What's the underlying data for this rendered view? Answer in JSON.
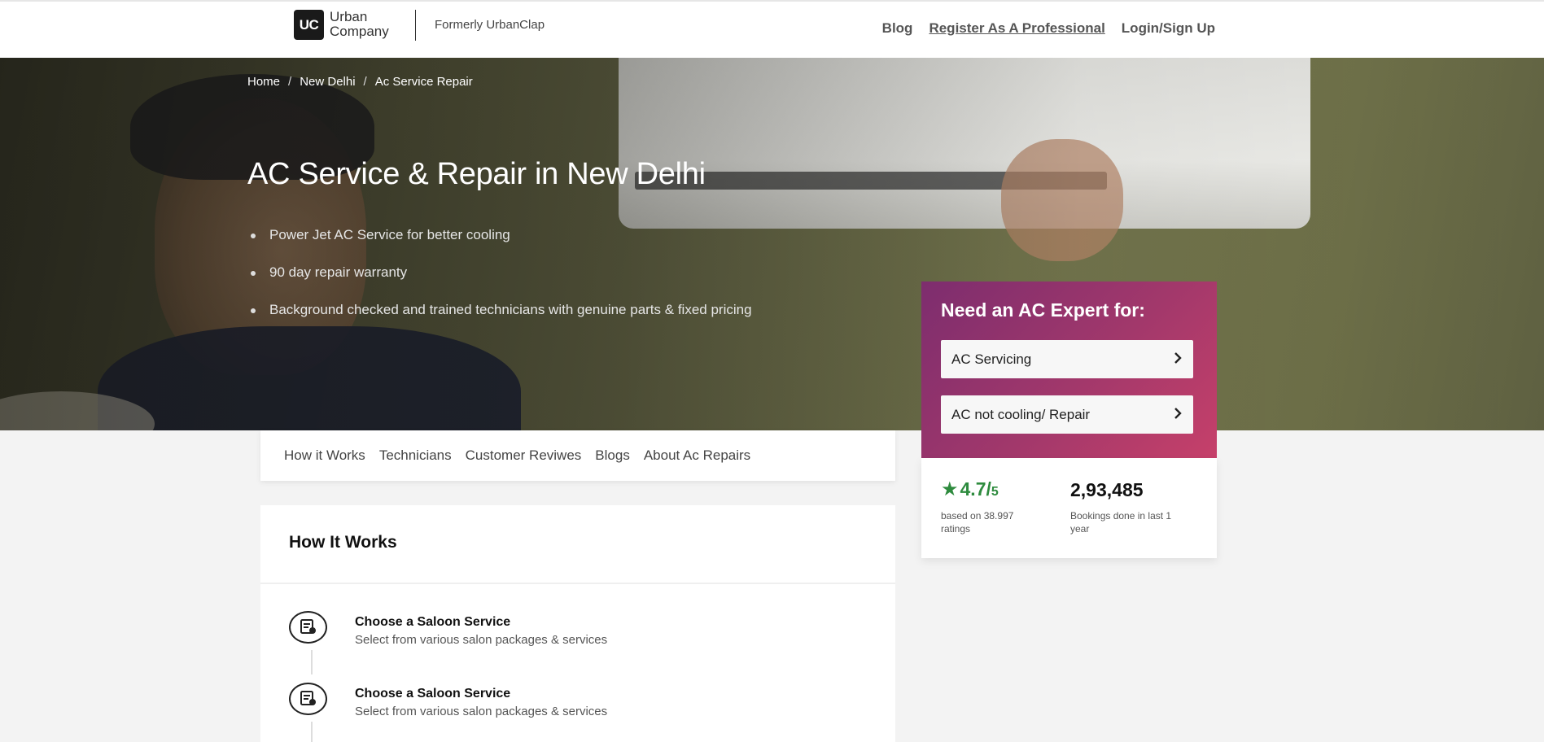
{
  "header": {
    "logo_mark": "UC",
    "logo_name_1": "Urban",
    "logo_name_2": "Company",
    "formerly": "Formerly UrbanClap",
    "nav": {
      "blog": "Blog",
      "register": "Register As A Professional",
      "login": "Login/Sign Up"
    }
  },
  "breadcrumb": {
    "home": "Home",
    "city": "New Delhi",
    "current": "Ac Service Repair",
    "separator": "/"
  },
  "hero": {
    "title": "AC Service & Repair in New Delhi",
    "bullets": [
      "Power Jet AC Service for better cooling",
      "90 day repair warranty",
      "Background checked and trained technicians with genuine parts & fixed pricing"
    ]
  },
  "expert_card": {
    "title": "Need an AC Expert for:",
    "options": [
      "AC Servicing",
      "AC not cooling/ Repair"
    ]
  },
  "stats": {
    "rating_value": "4.7",
    "rating_slash": "/",
    "rating_out_of": "5",
    "rating_sub": "based on 38.997 ratings",
    "bookings_value": "2,93,485",
    "bookings_sub": "Bookings done in last 1 year"
  },
  "subnav": [
    "How it Works",
    "Technicians",
    "Customer Reviwes",
    "Blogs",
    "About Ac Repairs"
  ],
  "how_it_works": {
    "title": "How It Works",
    "steps": [
      {
        "title": "Choose a Saloon Service",
        "desc": "Select from various salon packages & services"
      },
      {
        "title": "Choose a Saloon Service",
        "desc": "Select from various salon packages & services"
      }
    ]
  },
  "colors": {
    "rating_green": "#2e8b3e",
    "card_gradient_start": "#7d2d6e",
    "card_gradient_end": "#c6406a"
  },
  "icons": {
    "star": "star-icon",
    "chevron": "chevron-right-icon",
    "step": "service-list-icon"
  }
}
